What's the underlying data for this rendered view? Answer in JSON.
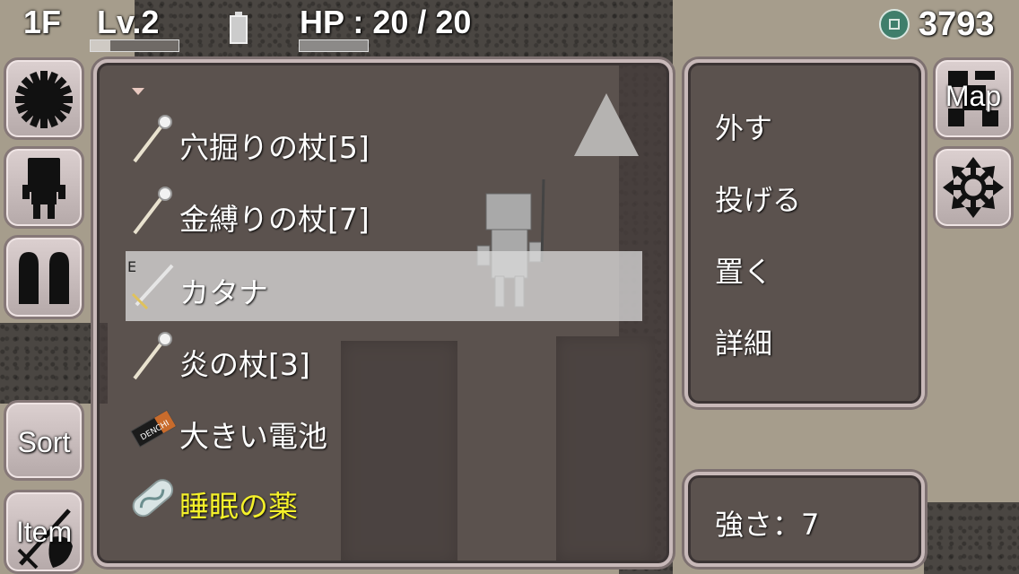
{
  "hud": {
    "floor": "1F",
    "level": "Lv.2",
    "level_progress": 0.22,
    "hp_label": "HP : 20 / 20",
    "hp_ratio": 1.0,
    "coins": "3793"
  },
  "side_buttons": {
    "map_label": "Map",
    "sort_label": "Sort",
    "item_label": "Item"
  },
  "items": [
    {
      "name": "穴掘りの杖[5]",
      "icon": "staff-icon",
      "equipped": false,
      "selected": false,
      "color": "#ffffff"
    },
    {
      "name": "金縛りの杖[7]",
      "icon": "staff-icon",
      "equipped": false,
      "selected": false,
      "color": "#ffffff"
    },
    {
      "name": "カタナ",
      "icon": "katana-icon",
      "equipped": true,
      "equip_mark": "E",
      "selected": true,
      "color": "#ffffff"
    },
    {
      "name": "炎の杖[3]",
      "icon": "staff-icon",
      "equipped": false,
      "selected": false,
      "color": "#ffffff"
    },
    {
      "name": "大きい電池",
      "icon": "battery-item-icon",
      "equipped": false,
      "selected": false,
      "color": "#ffffff"
    },
    {
      "name": "睡眠の薬",
      "icon": "medicine-icon",
      "equipped": false,
      "selected": false,
      "color": "#f4f02a"
    }
  ],
  "commands": [
    "外す",
    "投げる",
    "置く",
    "詳細"
  ],
  "detail": {
    "strength": "強さ：7"
  },
  "colors": {
    "highlight": "#dcdcdc",
    "special_item": "#f4f02a",
    "coin": "#3f7e6b"
  }
}
